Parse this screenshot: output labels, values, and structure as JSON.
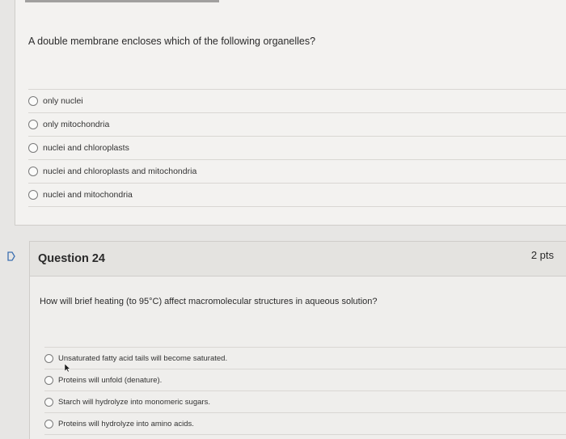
{
  "question23": {
    "text": "A double membrane encloses which of the following organelles?",
    "answers": [
      "only nuclei",
      "only mitochondria",
      "nuclei and chloroplasts",
      "nuclei and chloroplasts and mitochondria",
      "nuclei and mitochondria"
    ]
  },
  "question24": {
    "title": "Question 24",
    "points": "2 pts",
    "text": "How will brief heating (to 95°C) affect macromolecular structures in aqueous solution?",
    "answers": [
      "Unsaturated fatty acid tails will become saturated.",
      "Proteins will unfold (denature).",
      "Starch will hydrolyze into monomeric sugars.",
      "Proteins will hydrolyze into amino acids."
    ]
  },
  "icons": {
    "flag": "flag-icon",
    "cursor": "mouse-cursor-icon"
  },
  "colors": {
    "page_bg": "#e7e6e4",
    "card_bg": "#f3f2f0",
    "header_bg": "#e4e3e0",
    "text": "#2b2b2b"
  }
}
